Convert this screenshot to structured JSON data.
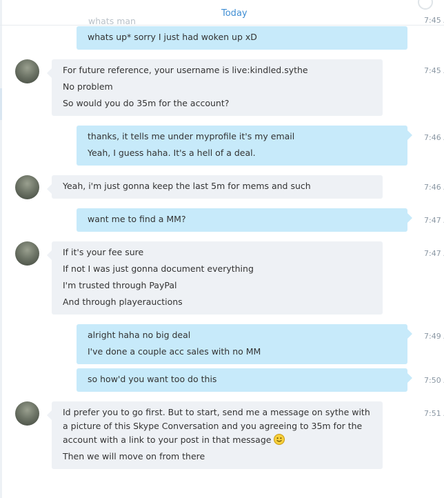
{
  "header": {
    "date_divider": "Today",
    "faded_previous": "whats man"
  },
  "messages": [
    {
      "id": "m1",
      "direction": "out",
      "lines": [
        "whats up* sorry I just had woken up xD"
      ],
      "time": "7:45 AM"
    },
    {
      "id": "m2",
      "direction": "in",
      "lines": [
        "For future reference, your username is live:kindled.sythe",
        "No problem",
        "So would you do 35m for the account?"
      ],
      "time": "7:45 AM"
    },
    {
      "id": "m3",
      "direction": "out",
      "lines": [
        "thanks, it tells me under myprofile it's my email",
        "Yeah, I guess haha. It's a hell of a deal."
      ],
      "time": "7:46 AM"
    },
    {
      "id": "m4",
      "direction": "in",
      "lines": [
        "Yeah, i'm just gonna keep the last 5m for mems and such"
      ],
      "time": "7:46 AM"
    },
    {
      "id": "m5",
      "direction": "out",
      "lines": [
        "want me to find a MM?"
      ],
      "time": "7:47 AM"
    },
    {
      "id": "m6",
      "direction": "in",
      "lines": [
        "If it's your fee sure",
        "If not I was just gonna document everything",
        "I'm trusted through PayPal",
        "And through playerauctions"
      ],
      "time": "7:47 AM"
    },
    {
      "id": "m7",
      "direction": "out",
      "lines": [
        "alright haha no big deal",
        "I've done a couple acc sales with no MM"
      ],
      "time": "7:49 AM"
    },
    {
      "id": "m8",
      "direction": "out",
      "lines": [
        "so how'd you want too do this"
      ],
      "time": "7:50 AM"
    },
    {
      "id": "m9",
      "direction": "in",
      "paragraph": "Id prefer you to go first. But to start, send me a message on sythe with a picture of this Skype Conversation and you agreeing to 35m for the account with a link to your post in that message",
      "emoji": "smile-emoji",
      "lines": [
        "Then we will move on from there"
      ],
      "time": "7:51 AM"
    }
  ]
}
